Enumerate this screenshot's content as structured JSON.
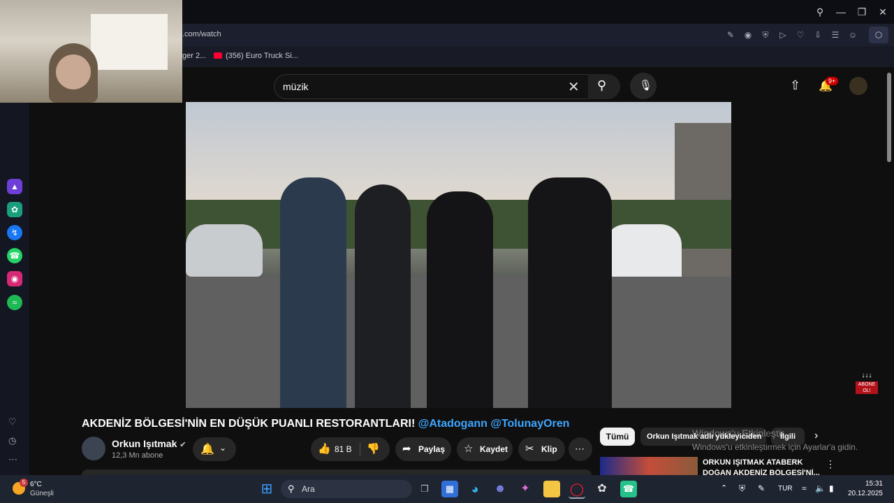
{
  "browser": {
    "url": ".com/watch",
    "bookmarks": [
      "ger 2...",
      "(356) Euro Truck Si..."
    ]
  },
  "youtube": {
    "search_value": "müzik",
    "notification_badge": "9+",
    "video": {
      "title": "AKDENİZ BÖLGESİ'NİN EN DÜŞÜK PUANLI RESTORANTLARI!",
      "mentions": "@Atadogann @TolunayOren",
      "overlay": "ABONE OL!"
    },
    "channel": {
      "name": "Orkun Işıtmak",
      "subscribers": "12,3 Mn abone"
    },
    "actions": {
      "likes": "81 B",
      "share": "Paylaş",
      "save": "Kaydet",
      "clip": "Klip"
    },
    "chips": {
      "all": "Tümü",
      "uploader": "Orkun Işıtmak adlı yükleyiciden",
      "related": "İlgili"
    },
    "recommended": {
      "title_line1": "ORKUN IŞITMAK ATABERK",
      "title_line2": "DOĞAN AKDENİZ BÖLGESİ'Nİ..."
    }
  },
  "windows_watermark": {
    "line1": "Windows'u Etkinleştir",
    "line2": "Windows'u etkinleştirmek için Ayarlar'a gidin."
  },
  "taskbar": {
    "weather_temp": "6°C",
    "weather_desc": "Güneşli",
    "weather_badge": "5",
    "search": "Ara",
    "language": "TUR",
    "time": "15:31",
    "date": "20.12.2025"
  }
}
